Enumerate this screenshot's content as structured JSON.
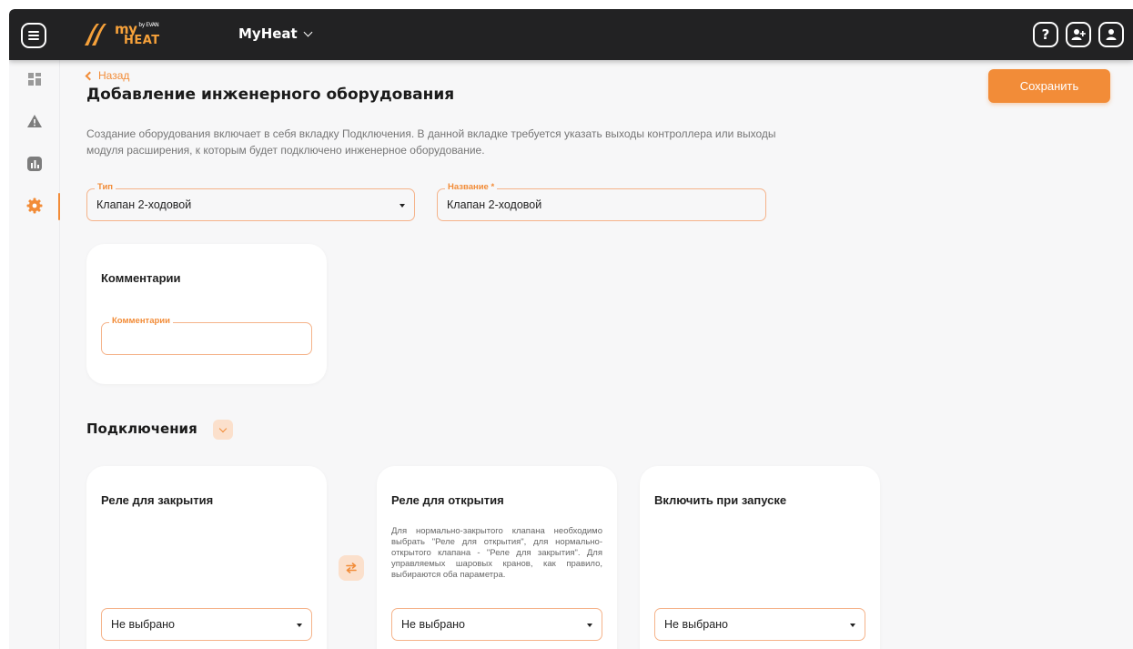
{
  "header": {
    "logo_text_top": "my",
    "logo_text_small": "by EVAN",
    "logo_text_bottom": "HEAT",
    "account_name": "MyHeat",
    "help_glyph": "?"
  },
  "icons": {
    "menu": "menu-icon",
    "help": "help-icon",
    "add_user": "add-user-icon",
    "profile": "profile-icon",
    "dashboard": "dashboard-icon",
    "warning": "warning-icon",
    "charts": "chart-icon",
    "settings": "gear-icon",
    "back": "chevron-left-icon",
    "swap": "swap-icon"
  },
  "sidebar": {
    "items": [
      {
        "id": "dashboard",
        "active": false
      },
      {
        "id": "alerts",
        "active": false
      },
      {
        "id": "analytics",
        "active": false
      },
      {
        "id": "settings",
        "active": true
      }
    ]
  },
  "page": {
    "back_label": "Назад",
    "title": "Добавление инженерного оборудования",
    "save_label": "Сохранить",
    "description": "Создание оборудования включает в себя вкладку Подключения. В данной вкладке требуется указать выходы контроллера или выходы модуля расширения, к которым будет подключено инженерное оборудование."
  },
  "form": {
    "type": {
      "label": "Тип",
      "value": "Клапан 2-ходовой"
    },
    "name": {
      "label": "Название *",
      "value": "Клапан 2-ходовой"
    }
  },
  "comments_card": {
    "title": "Комментарии",
    "field_label": "Комментарии",
    "field_value": ""
  },
  "connections": {
    "title": "Подключения",
    "cards": [
      {
        "title": "Реле для закрытия",
        "hint": "",
        "select_value": "Не выбрано"
      },
      {
        "title": "Реле для открытия",
        "hint": "Для нормально-закрытого клапана необходимо выбрать \"Реле для открытия\", для нормально-открытого клапана - \"Реле для закрытия\". Для управляемых шаровых кранов, как правило, выбираются оба параметра.",
        "select_value": "Не выбрано"
      },
      {
        "title": "Включить при запуске",
        "hint": "",
        "select_value": "Не выбрано"
      }
    ]
  },
  "colors": {
    "accent": "#f28c38",
    "topbar": "#222223",
    "background": "#f7f7f8"
  }
}
